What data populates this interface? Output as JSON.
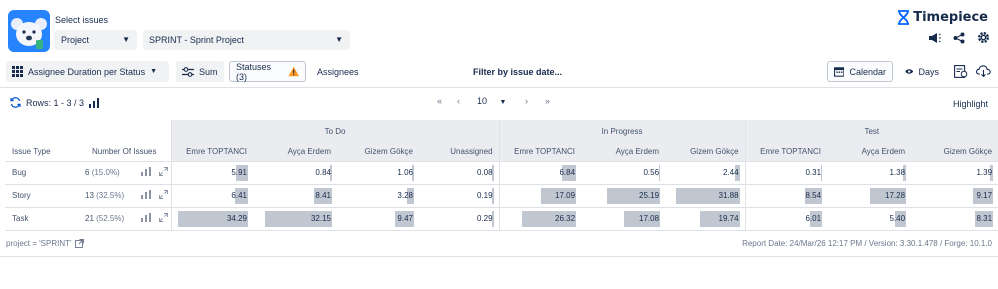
{
  "header": {
    "select_label": "Select issues",
    "project_dropdown": "Project",
    "sprint_dropdown": "SPRINT - Sprint Project",
    "brand": "Timepiece"
  },
  "toolbar": {
    "report_type": "Assignee Duration per Status",
    "sum": "Sum",
    "statuses": "Statuses (3)",
    "assignees": "Assignees",
    "filter": "Filter by issue date...",
    "calendar": "Calendar",
    "days": "Days"
  },
  "rows_bar": {
    "rows_text": "Rows: 1 - 3 / 3",
    "page_size": "10",
    "highlight": "Highlight"
  },
  "table": {
    "groups": [
      "To Do",
      "In Progress",
      "Test"
    ],
    "headers": [
      "Issue Type",
      "Number Of Issues",
      "Emre TOPTANCI",
      "Ayça Erdem",
      "Gizem Gökçe",
      "Unassigned",
      "Emre TOPTANCI",
      "Ayça Erdem",
      "Gizem Gökçe",
      "Emre TOPTANCI",
      "Ayça Erdem",
      "Gizem Gökçe"
    ],
    "rows": [
      {
        "type": "Bug",
        "count": "6",
        "pct": "(15.0%)",
        "values": [
          "5.91",
          "0.84",
          "1.06",
          "0.08",
          "6.84",
          "0.56",
          "2.44",
          "0.31",
          "1.38",
          "1.39"
        ]
      },
      {
        "type": "Story",
        "count": "13",
        "pct": "(32.5%)",
        "values": [
          "6.41",
          "8.41",
          "3.28",
          "0.19",
          "17.09",
          "25.19",
          "31.88",
          "8.54",
          "17.28",
          "9.17"
        ]
      },
      {
        "type": "Task",
        "count": "21",
        "pct": "(52.5%)",
        "values": [
          "34.29",
          "32.15",
          "9.47",
          "0.29",
          "26.32",
          "17.08",
          "19.74",
          "6.01",
          "5.40",
          "8.31"
        ]
      }
    ]
  },
  "footer": {
    "jql": "project = 'SPRINT'",
    "report_info": "Report Date: 24/Mar/26 12:17 PM / Version: 3.30.1.478 / Forge: 10.1.0"
  },
  "colors": {
    "accent": "#2684ff",
    "bar": "#c1c7d0",
    "group_header": "#ebecf0",
    "warning": "#ff991f"
  }
}
